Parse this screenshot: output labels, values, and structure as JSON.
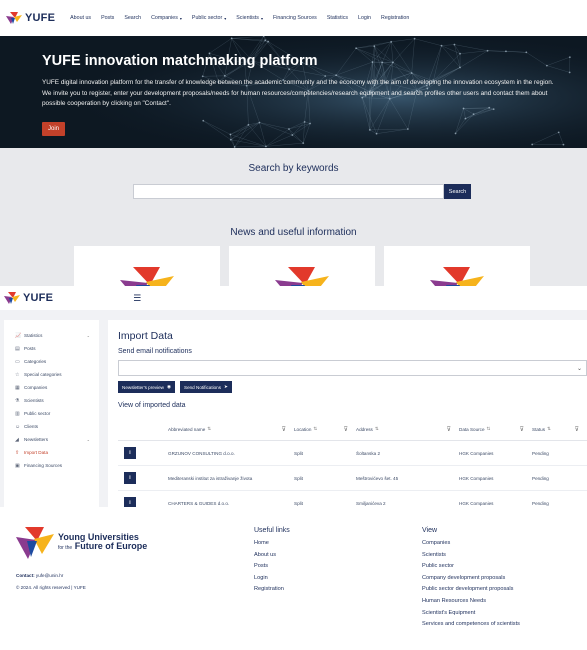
{
  "topnav": {
    "brand": "YUFE",
    "items": [
      {
        "label": "About us",
        "caret": false
      },
      {
        "label": "Posts",
        "caret": false
      },
      {
        "label": "Search",
        "caret": false
      },
      {
        "label": "Companies",
        "caret": true
      },
      {
        "label": "Public sector",
        "caret": true
      },
      {
        "label": "Scientists",
        "caret": true
      },
      {
        "label": "Financing Sources",
        "caret": false
      },
      {
        "label": "Statistics",
        "caret": false
      },
      {
        "label": "Login",
        "caret": false
      },
      {
        "label": "Registration",
        "caret": false
      }
    ]
  },
  "hero": {
    "title": "YUFE innovation matchmaking platform",
    "text": "YUFE digital innovation platform for the transfer of knowledge between the academic community and the economy with the aim of developing the innovation ecosystem in the region. We invite you to register, enter your development proposals/needs for human resources/competencies/research equipment and search profiles other users and contact them about possible cooperation by clicking on \"Contact\".",
    "join_label": "Join"
  },
  "search": {
    "title": "Search by keywords",
    "button_label": "Search",
    "value": ""
  },
  "news": {
    "title": "News and useful information"
  },
  "admin": {
    "brand": "YUFE",
    "sidebar": [
      {
        "label": "Statistics",
        "icon": "chart-icon",
        "glyph": "📈",
        "expandable": true,
        "active": false
      },
      {
        "label": "Posts",
        "icon": "document-icon",
        "glyph": "▤",
        "expandable": false,
        "active": false
      },
      {
        "label": "Categories",
        "icon": "folder-icon",
        "glyph": "▭",
        "expandable": false,
        "active": false
      },
      {
        "label": "Special categories",
        "icon": "star-icon",
        "glyph": "☆",
        "expandable": false,
        "active": false
      },
      {
        "label": "Companies",
        "icon": "building-icon",
        "glyph": "▦",
        "expandable": false,
        "active": false
      },
      {
        "label": "Scientists",
        "icon": "flask-icon",
        "glyph": "⚗",
        "expandable": false,
        "active": false
      },
      {
        "label": "Public sector",
        "icon": "institution-icon",
        "glyph": "▥",
        "expandable": false,
        "active": false
      },
      {
        "label": "Clients",
        "icon": "user-icon",
        "glyph": "☺",
        "expandable": false,
        "active": false
      },
      {
        "label": "Newsletters",
        "icon": "megaphone-icon",
        "glyph": "◢",
        "expandable": true,
        "active": false
      },
      {
        "label": "Import Data",
        "icon": "upload-icon",
        "glyph": "⇪",
        "expandable": false,
        "active": true
      },
      {
        "label": "Financing Sources",
        "icon": "money-icon",
        "glyph": "▣",
        "expandable": false,
        "active": false
      }
    ],
    "page_title": "Import Data",
    "email_label": "Send email notifications",
    "email_value": "",
    "newsletter_btn": "Newsletter's preview",
    "send_btn": "Send Notifications",
    "imported_label": "View of imported data",
    "table": {
      "headers": [
        "",
        "Abbreviated name",
        "Location",
        "Address",
        "Data Source",
        "Status"
      ],
      "rows": [
        {
          "info": "i",
          "name": "GRZUNOV CONSULTING d.o.o.",
          "location": "Split",
          "address": "Šoltanska 2",
          "source": "HGK Companies",
          "status": "Pending"
        },
        {
          "info": "i",
          "name": "Mediteranski institut za istraživanje života",
          "location": "Split",
          "address": "Meštrovićevo šet. 45",
          "source": "HGK Companies",
          "status": "Pending"
        },
        {
          "info": "i",
          "name": "CHARTERS & GUIDES d.o.o.",
          "location": "Split",
          "address": "Smiljanićeva 2",
          "source": "HGK Companies",
          "status": "Pending"
        }
      ]
    }
  },
  "footer": {
    "logo_line1": "Young Universities",
    "logo_line2a": "for the",
    "logo_line2b": "Future of Europe",
    "contact_label": "Contact:",
    "contact_email": "yufe@unin.hr",
    "copyright": "© 2024. All rights reserved | YUFE",
    "useful_title": "Useful links",
    "useful_links": [
      "Home",
      "About us",
      "Posts",
      "Login",
      "Registration"
    ],
    "view_title": "View",
    "view_links": [
      "Companies",
      "Scientists",
      "Public sector",
      "Company development proposals",
      "Public sector development proposals",
      "Human Resources Needs",
      "Scientist's Equipment",
      "Services and competences of scientists"
    ]
  },
  "colors": {
    "navy": "#1c2d5a",
    "accent": "#c3412a",
    "logo_red": "#e2392b",
    "logo_yellow": "#f6b31c",
    "logo_blue": "#1e4aa0",
    "logo_purple": "#8a3b8f"
  }
}
